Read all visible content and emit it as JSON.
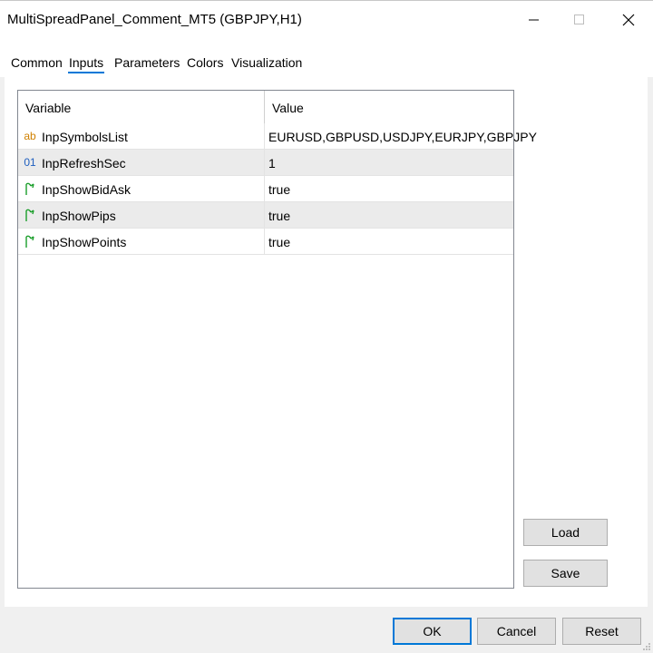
{
  "window": {
    "title": "MultiSpreadPanel_Comment_MT5 (GBPJPY,H1)"
  },
  "tabs": [
    {
      "label": "Common",
      "active": false
    },
    {
      "label": "Inputs",
      "active": true
    },
    {
      "label": "Parameters",
      "active": false
    },
    {
      "label": "Colors",
      "active": false
    },
    {
      "label": "Visualization",
      "active": false
    }
  ],
  "grid": {
    "headers": {
      "variable": "Variable",
      "value": "Value"
    },
    "rows": [
      {
        "icon": "string-type-icon",
        "icon_text": "ab",
        "variable": "InpSymbolsList",
        "value": "EURUSD,GBPUSD,USDJPY,EURJPY,GBPJPY"
      },
      {
        "icon": "integer-type-icon",
        "icon_text": "01",
        "variable": "InpRefreshSec",
        "value": "1"
      },
      {
        "icon": "bool-type-icon",
        "icon_text": "",
        "variable": "InpShowBidAsk",
        "value": "true"
      },
      {
        "icon": "bool-type-icon",
        "icon_text": "",
        "variable": "InpShowPips",
        "value": "true"
      },
      {
        "icon": "bool-type-icon",
        "icon_text": "",
        "variable": "InpShowPoints",
        "value": "true"
      }
    ]
  },
  "side_buttons": {
    "load": "Load",
    "save": "Save"
  },
  "footer": {
    "ok": "OK",
    "cancel": "Cancel",
    "reset": "Reset"
  },
  "colors": {
    "accent": "#0078d7",
    "bool_icon": "#1a9e2a",
    "string_icon": "#d08000",
    "int_icon": "#1f5fbf"
  }
}
